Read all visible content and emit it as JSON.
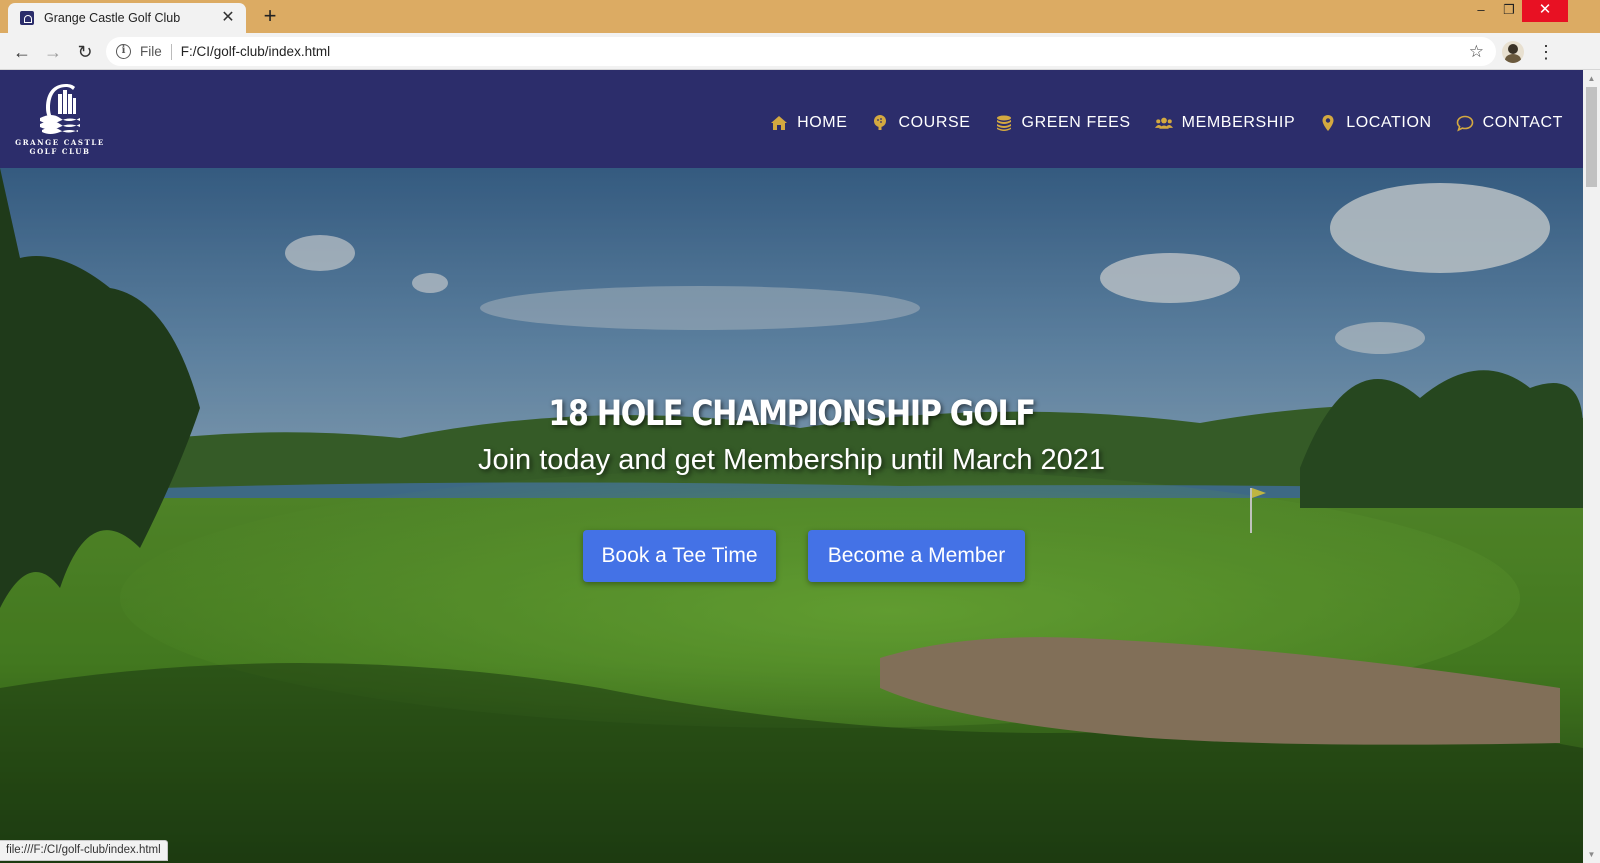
{
  "browser": {
    "tab_title": "Grange Castle Golf Club",
    "tab_close": "✕",
    "new_tab": "+",
    "scheme_label": "File",
    "url": "F:/CI/golf-club/index.html",
    "status_url": "file:///F:/CI/golf-club/index.html",
    "window_controls": {
      "minimize": "–",
      "maximize": "❐",
      "close": "✕"
    },
    "nav": {
      "back": "←",
      "forward": "→",
      "reload": "↻",
      "bookmark": "☆",
      "menu": "⋮"
    }
  },
  "site": {
    "logo": {
      "line1": "GRANGE CASTLE",
      "line2": "GOLF CLUB"
    },
    "nav_items": [
      {
        "label": "HOME",
        "icon": "home-icon"
      },
      {
        "label": "COURSE",
        "icon": "golf-ball-icon"
      },
      {
        "label": "GREEN FEES",
        "icon": "coins-icon"
      },
      {
        "label": "MEMBERSHIP",
        "icon": "users-icon"
      },
      {
        "label": "LOCATION",
        "icon": "map-marker-icon"
      },
      {
        "label": "CONTACT",
        "icon": "chat-bubble-icon"
      }
    ],
    "hero": {
      "title": "18 HOLE CHAMPIONSHIP GOLF",
      "subtitle": "Join today and get Membership until March 2021",
      "primary_button": "Book a Tee Time",
      "secondary_button": "Become a Member"
    }
  },
  "colors": {
    "header_bg": "#2c2d6b",
    "nav_icon": "#d4a940",
    "button_bg": "#4472e6",
    "tabbar_bg": "#dcab63",
    "close_button": "#e81123"
  }
}
